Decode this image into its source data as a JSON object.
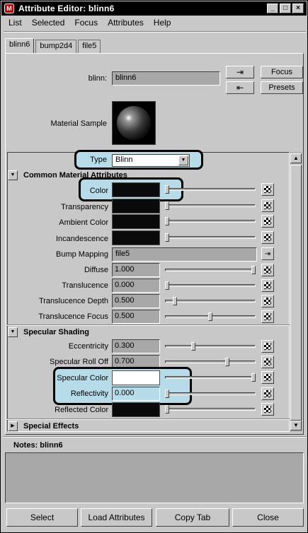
{
  "window": {
    "title": "Attribute Editor: blinn6",
    "app_icon": "maya-icon"
  },
  "menubar": {
    "items": [
      "List",
      "Selected",
      "Focus",
      "Attributes",
      "Help"
    ]
  },
  "tabs": [
    {
      "label": "blinn6",
      "active": true
    },
    {
      "label": "bump2d4",
      "active": false
    },
    {
      "label": "file5",
      "active": false
    }
  ],
  "header": {
    "node_label": "blinn:",
    "node_value": "blinn6",
    "focus_label": "Focus",
    "presets_label": "Presets",
    "material_sample_label": "Material Sample"
  },
  "type_row": {
    "label": "Type",
    "value": "Blinn"
  },
  "sections": {
    "common": "Common Material Attributes",
    "specular": "Specular Shading",
    "special": "Special Effects"
  },
  "common_attrs": {
    "color": {
      "label": "Color",
      "swatch": "#0a0a0a",
      "slider": 0.0
    },
    "transparency": {
      "label": "Transparency",
      "swatch": "#0a0a0a",
      "slider": 0.0
    },
    "ambient": {
      "label": "Ambient Color",
      "swatch": "#0a0a0a",
      "slider": 0.0
    },
    "incandescence": {
      "label": "Incandescence",
      "swatch": "#0a0a0a",
      "slider": 0.0
    },
    "bump": {
      "label": "Bump Mapping",
      "value": "file5"
    },
    "diffuse": {
      "label": "Diffuse",
      "value": "1.000",
      "slider": 1.0
    },
    "translucence": {
      "label": "Translucence",
      "value": "0.000",
      "slider": 0.0
    },
    "trans_depth": {
      "label": "Translucence Depth",
      "value": "0.500",
      "slider": 0.1
    },
    "trans_focus": {
      "label": "Translucence Focus",
      "value": "0.500",
      "slider": 0.5
    }
  },
  "specular_attrs": {
    "eccentricity": {
      "label": "Eccentricity",
      "value": "0.300",
      "slider": 0.3
    },
    "rolloff": {
      "label": "Specular Roll Off",
      "value": "0.700",
      "slider": 0.7
    },
    "spec_color": {
      "label": "Specular Color",
      "swatch": "#ffffff",
      "slider": 1.0
    },
    "reflectivity": {
      "label": "Reflectivity",
      "value": "0.000",
      "slider": 0.0
    },
    "reflected": {
      "label": "Reflected Color",
      "swatch": "#0a0a0a",
      "slider": 0.0
    }
  },
  "notes": {
    "label": "Notes:  blinn6"
  },
  "bottom_buttons": {
    "select": "Select",
    "load": "Load Attributes",
    "copy": "Copy Tab",
    "close": "Close"
  },
  "colors": {
    "highlight": "#b6dce9",
    "panel": "#c8c8c8",
    "field": "#a8a8a8"
  }
}
